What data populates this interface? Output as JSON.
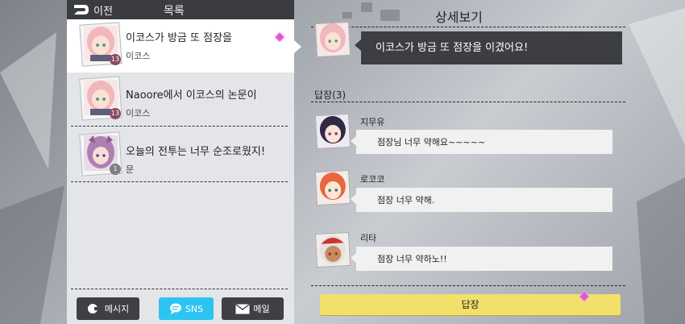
{
  "header": {
    "back_label": "이전",
    "list_title": "목록"
  },
  "messages": [
    {
      "title": "이코스가 방금 또 점장을",
      "sender": "이코스",
      "badge": "13"
    },
    {
      "title": "Naoore에서 이코스의 논문이",
      "sender": "이코스",
      "badge": "13"
    },
    {
      "title": "오늘의 전투는 너무 순조로웠지!",
      "sender": "문",
      "badge": "1"
    }
  ],
  "tabs": {
    "message": "메시지",
    "sns": "SNS",
    "mail": "메일"
  },
  "detail": {
    "title": "상세보기",
    "main_message": "이코스가 방금 또 점장을 이겼어요!",
    "reply_count": "답장(3)",
    "replies": [
      {
        "name": "지무유",
        "text": "점장님 너무 약해요~~~~~"
      },
      {
        "name": "로코코",
        "text": "점장 너무 약해."
      },
      {
        "name": "리타",
        "text": "점장 너무 약하노!!"
      }
    ],
    "reply_button": "답장"
  },
  "colors": {
    "accent_sns": "#2ec4f2",
    "reply_button": "#f3e06b",
    "header_dark": "#3a3c41",
    "unread_dot": "#e05ad8"
  }
}
